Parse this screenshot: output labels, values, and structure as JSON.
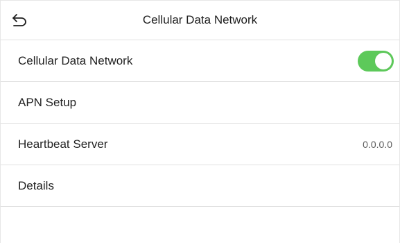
{
  "header": {
    "back_icon": "back-arrow-icon",
    "title": "Cellular Data Network"
  },
  "rows": [
    {
      "label": "Cellular Data Network",
      "control": "toggle",
      "toggle_on": true
    },
    {
      "label": "APN Setup"
    },
    {
      "label": "Heartbeat Server",
      "value": "0.0.0.0"
    },
    {
      "label": "Details"
    }
  ],
  "colors": {
    "toggle_on": "#5dc95a",
    "divider": "#e0e0e0",
    "text": "#222222",
    "secondary_text": "#5a5a5a"
  }
}
